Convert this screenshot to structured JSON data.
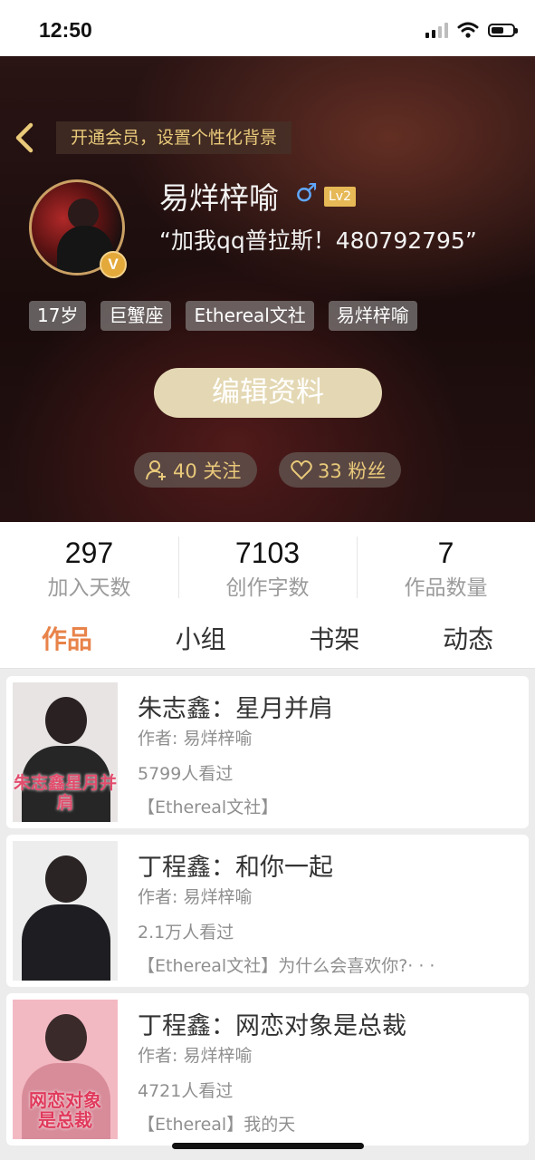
{
  "status_bar": {
    "time": "12:50"
  },
  "header": {
    "vip_banner": "开通会员，设置个性化背景",
    "username": "易烊梓喻",
    "gender_symbol": "♂",
    "level": "Lv2",
    "bio": "“加我qq普拉斯！480792795”",
    "avatar_badge": "V",
    "tags": [
      "17岁",
      "巨蟹座",
      "Ethereal文社",
      "易烊梓喻"
    ],
    "edit_button": "编辑资料",
    "following": "40 关注",
    "fans": "33 粉丝"
  },
  "stats": [
    {
      "value": "297",
      "label": "加入天数"
    },
    {
      "value": "7103",
      "label": "创作字数"
    },
    {
      "value": "7",
      "label": "作品数量"
    }
  ],
  "tabs": [
    {
      "label": "作品",
      "active": true
    },
    {
      "label": "小组",
      "active": false
    },
    {
      "label": "书架",
      "active": false
    },
    {
      "label": "动态",
      "active": false
    }
  ],
  "works": [
    {
      "title": "朱志鑫：星月并肩",
      "author": "作者: 易烊梓喻",
      "views": "5799人看过",
      "desc": "【Ethereal文社】",
      "cover_text": "朱志鑫星月并肩"
    },
    {
      "title": "丁程鑫：和你一起",
      "author": "作者: 易烊梓喻",
      "views": "2.1万人看过",
      "desc": "【Ethereal文社】为什么会喜欢你?· · ·",
      "cover_text": ""
    },
    {
      "title": "丁程鑫：网恋对象是总裁",
      "author": "作者: 易烊梓喻",
      "views": "4721人看过",
      "desc": "【Ethereal】我的天",
      "cover_text": "网恋对象是总裁"
    }
  ],
  "colors": {
    "accent": "#e8834a",
    "gold": "#e9c97a",
    "edit_button": "#e4d8b4"
  }
}
